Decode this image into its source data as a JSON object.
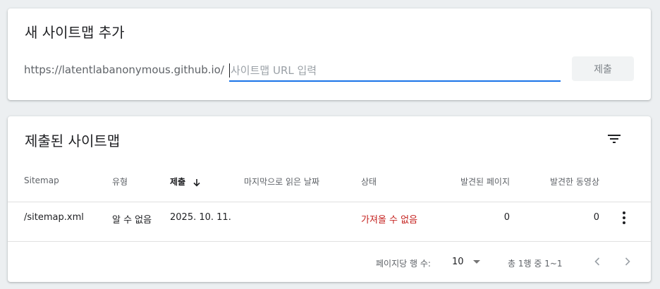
{
  "add_card": {
    "title": "새 사이트맵 추가",
    "url_prefix": "https://latentlabanonymous.github.io/",
    "input_placeholder": "사이트맵 URL 입력",
    "input_value": "",
    "submit_label": "제출"
  },
  "list_card": {
    "title": "제출된 사이트맵",
    "columns": {
      "sitemap": "Sitemap",
      "type": "유형",
      "submitted": "제출",
      "last_read": "마지막으로 읽은 날짜",
      "status": "상태",
      "pages": "발견된 페이지",
      "videos": "발견한 동영상"
    },
    "rows": [
      {
        "sitemap": "/sitemap.xml",
        "type": "알 수 없음",
        "submitted": "2025. 10. 11.",
        "last_read": "",
        "status": "가져올 수 없음",
        "pages": "0",
        "videos": "0"
      }
    ],
    "pagination": {
      "rows_per_page_label": "페이지당 행 수:",
      "rows_per_page": "10",
      "range": "총 1행 중 1~1"
    }
  },
  "icons": {
    "filter": "filter-icon",
    "sort": "arrow-down-icon",
    "more": "more-vert-icon",
    "prev": "chevron-left-icon",
    "next": "chevron-right-icon"
  },
  "colors": {
    "background": "#eceff1",
    "accent": "#1a73e8",
    "error": "#c5221f",
    "muted_text": "#5f6368"
  }
}
